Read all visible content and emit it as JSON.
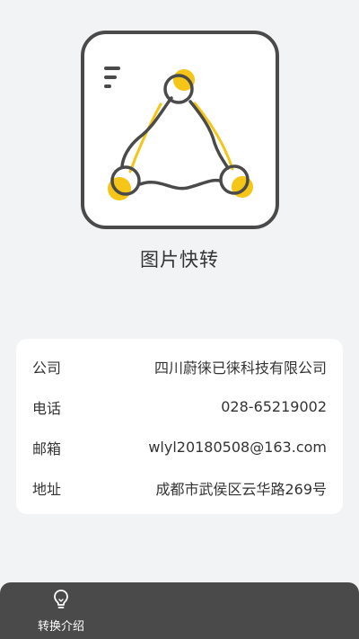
{
  "app": {
    "name": "图片快转"
  },
  "info": {
    "rows": [
      {
        "label": "公司",
        "value": "四川蔚徕已徕科技有限公司"
      },
      {
        "label": "电话",
        "value": "028-65219002"
      },
      {
        "label": "邮箱",
        "value": "wlyl20180508@163.com"
      },
      {
        "label": "地址",
        "value": "成都市武侯区云华路269号"
      }
    ]
  },
  "bottom_bar": {
    "tab_label": "转换介绍",
    "tab_icon": "lightbulb-icon"
  },
  "colors": {
    "accent": "#f5c518",
    "dark": "#4a4a4a",
    "background": "#f2f3f5"
  }
}
